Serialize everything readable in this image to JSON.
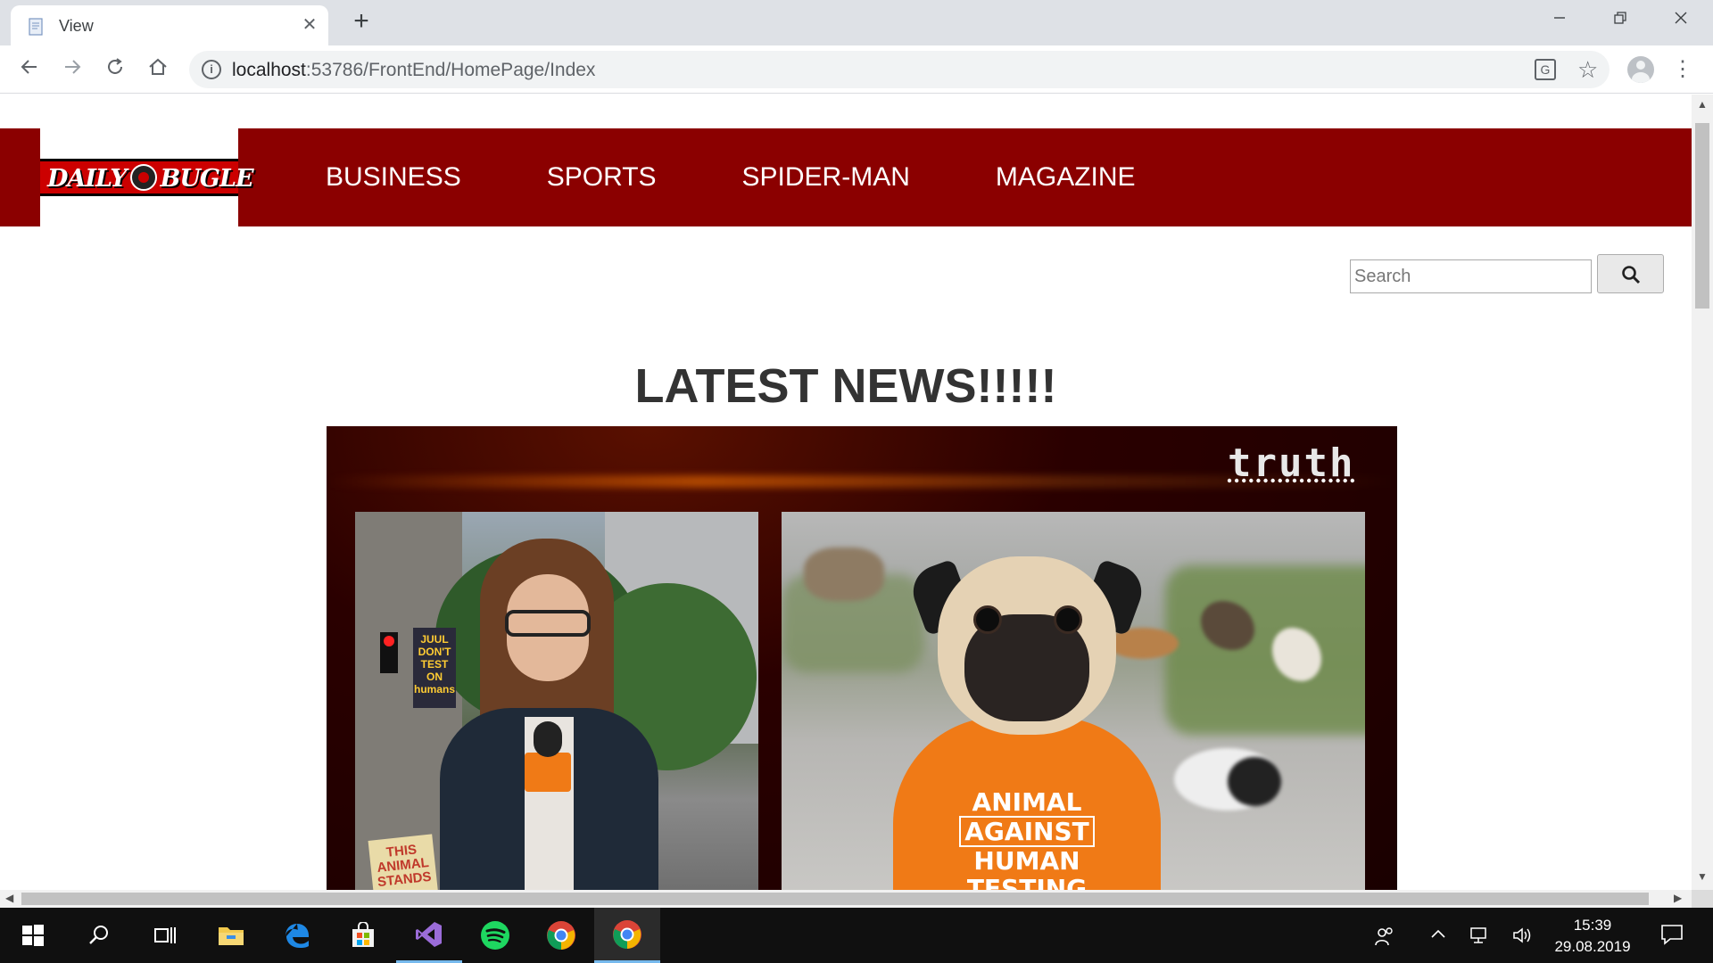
{
  "browser": {
    "tab_title": "View",
    "url_host": "localhost",
    "url_rest": ":53786/FrontEnd/HomePage/Index",
    "new_tab_symbol": "+",
    "close_symbol": "✕"
  },
  "site": {
    "logo_text_left": "DAILY",
    "logo_text_right": "BUGLE",
    "nav": [
      "BUSINESS",
      "SPORTS",
      "SPIDER-MAN",
      "MAGAZINE"
    ],
    "search": {
      "placeholder": "Search"
    },
    "headline": "LATEST NEWS!!!!!",
    "image": {
      "brand": "truth",
      "left_sign": "JUUL DON'T TEST ON humans",
      "bottom_sign": "THIS ANIMAL STANDS",
      "shirt_line1": "ANIMAL",
      "shirt_line2": "AGAINST",
      "shirt_line3": "HUMAN",
      "shirt_line4": "TESTING"
    }
  },
  "taskbar": {
    "time": "15:39",
    "date": "29.08.2019"
  },
  "colors": {
    "header_red": "#8b0000",
    "chrome_frame": "#dee1e6",
    "taskbar": "#101010"
  }
}
